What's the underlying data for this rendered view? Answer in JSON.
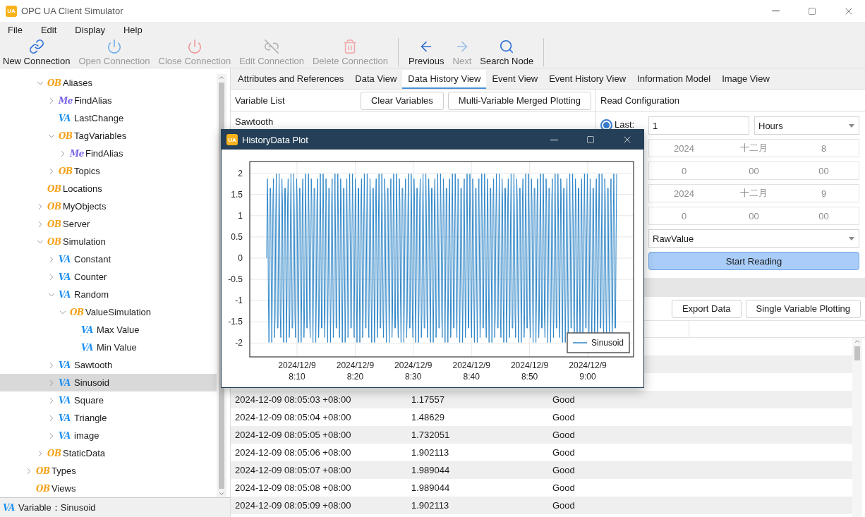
{
  "window": {
    "title": "OPC UA Client Simulator",
    "icon_text": "UA"
  },
  "menu": [
    "File",
    "Edit",
    "Display",
    "Help"
  ],
  "toolbar": {
    "groups": [
      [
        {
          "label": "New Connection",
          "disabled": false
        },
        {
          "label": "Open Connection",
          "disabled": true
        },
        {
          "label": "Close Connection",
          "disabled": true
        },
        {
          "label": "Edit Connection",
          "disabled": true
        },
        {
          "label": "Delete Connection",
          "disabled": true
        }
      ],
      [
        {
          "label": "Previous",
          "disabled": false
        },
        {
          "label": "Next",
          "disabled": true
        },
        {
          "label": "Search Node",
          "disabled": false
        }
      ]
    ]
  },
  "tree": {
    "items": [
      {
        "children": [
          {
            "label": "Aliases",
            "kind": "object",
            "badge": "OB",
            "expanded": true,
            "selected": false,
            "children": [
              {
                "label": "FindAlias",
                "kind": "method",
                "badge": "Me",
                "expanded": false,
                "selected": false
              },
              {
                "label": "LastChange",
                "kind": "variable",
                "badge": "VA",
                "selected": false
              },
              {
                "label": "TagVariables",
                "kind": "object",
                "badge": "OB",
                "expanded": true,
                "selected": false,
                "children": [
                  {
                    "label": "FindAlias",
                    "kind": "method",
                    "badge": "Me",
                    "expanded": false,
                    "selected": false
                  }
                ]
              },
              {
                "label": "Topics",
                "kind": "object",
                "badge": "OB",
                "expanded": false,
                "selected": false
              }
            ]
          },
          {
            "label": "Locations",
            "kind": "object",
            "badge": "OB",
            "selected": false
          },
          {
            "label": "MyObjects",
            "kind": "object",
            "badge": "OB",
            "expanded": false,
            "selected": false
          },
          {
            "label": "Server",
            "kind": "object",
            "badge": "OB",
            "expanded": false,
            "selected": false
          },
          {
            "label": "Simulation",
            "kind": "object",
            "badge": "OB",
            "expanded": true,
            "selected": false,
            "children": [
              {
                "label": "Constant",
                "kind": "variable",
                "badge": "VA",
                "expanded": false,
                "selected": false
              },
              {
                "label": "Counter",
                "kind": "variable",
                "badge": "VA",
                "expanded": false,
                "selected": false
              },
              {
                "label": "Random",
                "kind": "variable",
                "badge": "VA",
                "expanded": true,
                "selected": false,
                "children": [
                  {
                    "label": "ValueSimulation",
                    "kind": "object",
                    "badge": "OB",
                    "expanded": true,
                    "selected": false,
                    "children": [
                      {
                        "label": "Max Value",
                        "kind": "variable",
                        "badge": "VA",
                        "selected": false
                      },
                      {
                        "label": "Min Value",
                        "kind": "variable",
                        "badge": "VA",
                        "selected": false
                      }
                    ]
                  }
                ]
              },
              {
                "label": "Sawtooth",
                "kind": "variable",
                "badge": "VA",
                "expanded": false,
                "selected": false
              },
              {
                "label": "Sinusoid",
                "kind": "variable",
                "badge": "VA",
                "expanded": false,
                "selected": true
              },
              {
                "label": "Square",
                "kind": "variable",
                "badge": "VA",
                "expanded": false,
                "selected": false
              },
              {
                "label": "Triangle",
                "kind": "variable",
                "badge": "VA",
                "expanded": false,
                "selected": false
              },
              {
                "label": "image",
                "kind": "variable",
                "badge": "VA",
                "expanded": false,
                "selected": false
              }
            ]
          },
          {
            "label": "StaticData",
            "kind": "object",
            "badge": "OB",
            "expanded": false,
            "selected": false
          }
        ]
      },
      {
        "label": "Types",
        "kind": "object",
        "badge": "OB",
        "expanded": false,
        "selected": false
      },
      {
        "label": "Views",
        "kind": "object",
        "badge": "OB",
        "selected": false
      }
    ]
  },
  "status_bar": {
    "badge": "VA",
    "kind": "variable",
    "text": "Variable：Sinusoid"
  },
  "tabs": [
    {
      "label": "Attributes and References",
      "selected": false
    },
    {
      "label": "Data View",
      "selected": false
    },
    {
      "label": "Data History View",
      "selected": true
    },
    {
      "label": "Event View",
      "selected": false
    },
    {
      "label": "Event History View",
      "selected": false
    },
    {
      "label": "Information Model",
      "selected": false
    },
    {
      "label": "Image View",
      "selected": false
    }
  ],
  "variable_list": {
    "title": "Variable List",
    "buttons": [
      "Clear Variables",
      "Multi-Variable Merged Plotting"
    ],
    "items": [
      "Sawtooth"
    ]
  },
  "read_configuration": {
    "title": "Read Configuration",
    "mode": {
      "label": "Last:",
      "selected": true
    },
    "last_value": "1",
    "unit": "Hours",
    "dates_disabled": true,
    "date_rows": [
      [
        "2024",
        "十二月",
        "8"
      ],
      [
        "0",
        "00",
        "00"
      ],
      [
        "2024",
        "十二月",
        "9"
      ],
      [
        "0",
        "00",
        "00"
      ]
    ],
    "aggregate": "RawValue",
    "button": "Start Reading"
  },
  "results": {
    "buttons": [
      "Export Data",
      "Single Variable Plotting"
    ],
    "rows": [
      {
        "timestamp": "2024-12-09 08:05:03 +08:00",
        "value": "1.17557",
        "status": "Good"
      },
      {
        "timestamp": "2024-12-09 08:05:04 +08:00",
        "value": "1.48629",
        "status": "Good"
      },
      {
        "timestamp": "2024-12-09 08:05:05 +08:00",
        "value": "1.732051",
        "status": "Good"
      },
      {
        "timestamp": "2024-12-09 08:05:06 +08:00",
        "value": "1.902113",
        "status": "Good"
      },
      {
        "timestamp": "2024-12-09 08:05:07 +08:00",
        "value": "1.989044",
        "status": "Good"
      },
      {
        "timestamp": "2024-12-09 08:05:08 +08:00",
        "value": "1.989044",
        "status": "Good"
      },
      {
        "timestamp": "2024-12-09 08:05:09 +08:00",
        "value": "1.902113",
        "status": "Good"
      }
    ]
  },
  "plot_window": {
    "title": "HistoryData Plot",
    "icon_text": "UA",
    "yticks": [
      "2",
      "1.5",
      "1",
      "0.5",
      "0",
      "-0.5",
      "-1",
      "-1.5",
      "-2"
    ],
    "xticks": [
      {
        "date": "2024/12/9",
        "time": "8:10"
      },
      {
        "date": "2024/12/9",
        "time": "8:20"
      },
      {
        "date": "2024/12/9",
        "time": "8:30"
      },
      {
        "date": "2024/12/9",
        "time": "8:40"
      },
      {
        "date": "2024/12/9",
        "time": "8:50"
      },
      {
        "date": "2024/12/9",
        "time": "9:00"
      }
    ],
    "legend": "Sinusoid"
  }
}
